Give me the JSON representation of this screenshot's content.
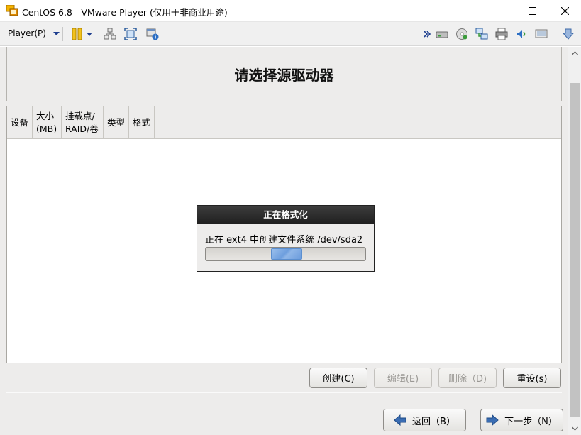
{
  "window": {
    "title": "CentOS 6.8 - VMware Player (仅用于非商业用途)",
    "icon": "vmware-player-icon"
  },
  "toolbar": {
    "player_menu": "Player(P)",
    "icons": [
      "pause-icon",
      "send-ctrl-alt-del-icon",
      "fullscreen-icon",
      "unity-icon",
      "more-chevron-icon",
      "hard-disk-icon",
      "cd-dvd-icon",
      "network-adapter-icon",
      "printer-icon",
      "sound-card-icon",
      "display-icon",
      "download-icon"
    ]
  },
  "installer": {
    "heading": "请选择源驱动器",
    "table": {
      "columns": [
        "设备",
        "大小\n(MB)",
        "挂载点/\nRAID/卷",
        "类型",
        "格式"
      ],
      "rows": []
    },
    "dialog": {
      "title": "正在格式化",
      "message": "正在 ext4 中创建文件系统 /dev/sda2",
      "progress_state": "pulsing"
    },
    "actions": {
      "create": "创建(C)",
      "edit": "编辑(E)",
      "delete": "删除（D)",
      "reset": "重设(s)"
    },
    "nav": {
      "back": "返回（B）",
      "next": "下一步（N）"
    }
  },
  "colors": {
    "dialog_title_bg": "#2b2b2b",
    "progress_fill": "#6d9ede",
    "nav_arrow": "#2f5fa3"
  }
}
